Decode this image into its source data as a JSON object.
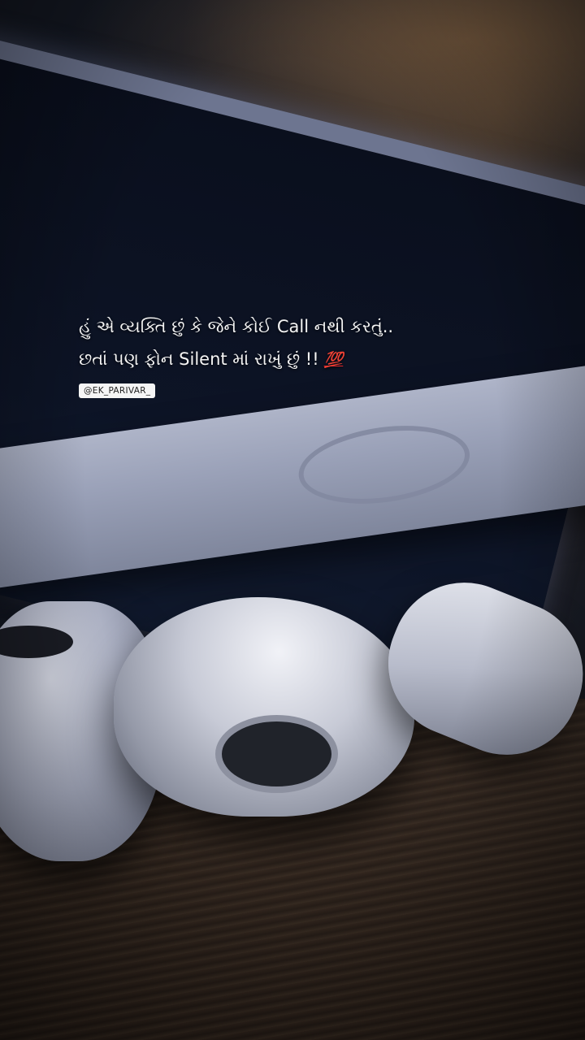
{
  "quote": {
    "line1": "હું એ વ્યક્તિ છું કે જેને કોઈ Call નથી કરતું..",
    "line2": "છતાં પણ ફોન Silent માં રાખું છું !!",
    "emoji": "💯"
  },
  "handle": {
    "text": "@EK_PARIVAR_"
  }
}
